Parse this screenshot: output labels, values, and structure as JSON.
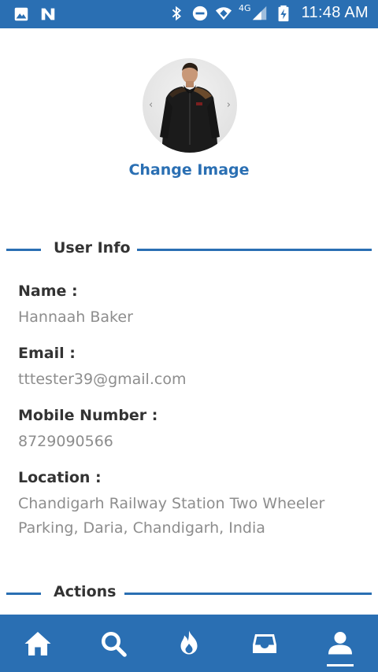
{
  "status_bar": {
    "time": "11:48 AM",
    "network": "4G",
    "left_icons": [
      "image-icon",
      "n-app-icon"
    ],
    "right_icons": [
      "bluetooth-icon",
      "do-not-disturb-icon",
      "wifi-icon",
      "signal-icon",
      "battery-charging-icon"
    ]
  },
  "profile": {
    "prev_arrow": "‹",
    "next_arrow": "›",
    "change_image_label": "Change Image"
  },
  "user_info": {
    "section_title": "User Info",
    "fields": [
      {
        "label": "Name :",
        "value": "Hannaah Baker"
      },
      {
        "label": "Email :",
        "value": "tttester39@gmail.com"
      },
      {
        "label": "Mobile Number :",
        "value": "8729090566"
      },
      {
        "label": "Location :",
        "value": "Chandigarh Railway Station Two Wheeler Parking, Daria, Chandigarh, India"
      }
    ]
  },
  "actions": {
    "section_title": "Actions"
  },
  "bottom_nav": {
    "items": [
      "home-icon",
      "search-icon",
      "flame-icon",
      "inbox-icon",
      "profile-icon"
    ],
    "active": "profile-icon"
  },
  "colors": {
    "primary": "#2a6fb3",
    "label_text": "#333333",
    "value_text": "#8d8d8d"
  }
}
